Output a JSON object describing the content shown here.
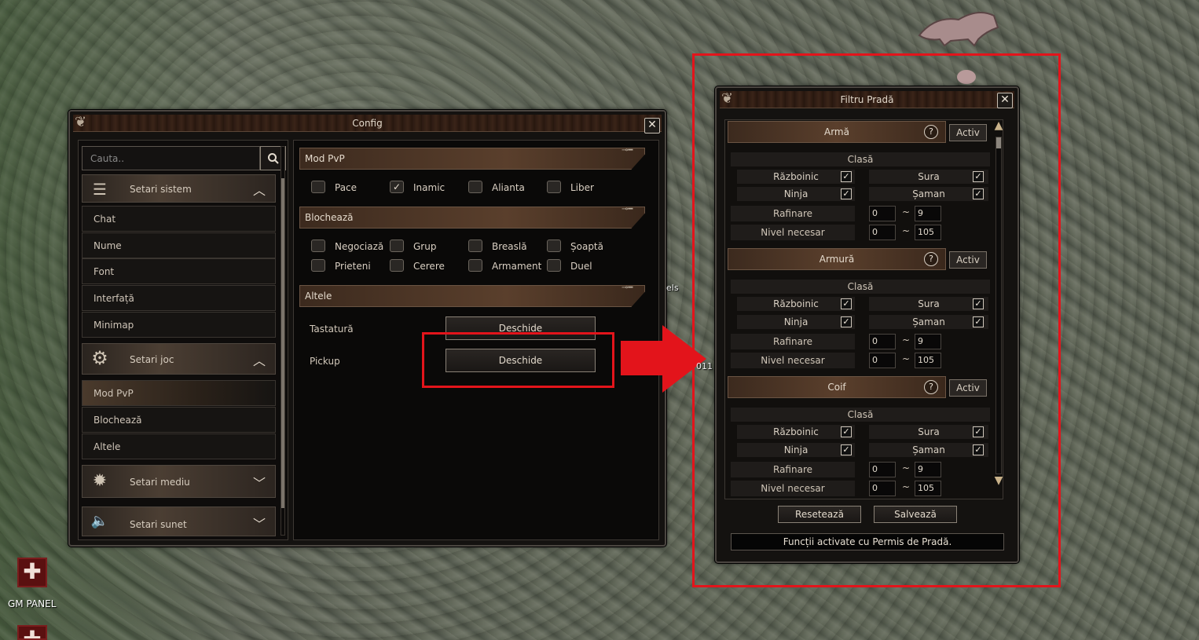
{
  "config": {
    "title": "Config",
    "search_placeholder": "Cauta..",
    "categories": [
      {
        "label": "Setari sistem",
        "icon": "list-icon",
        "expanded": true
      },
      {
        "label": "Setari joc",
        "icon": "gear-icon",
        "expanded": true
      },
      {
        "label": "Setari mediu",
        "icon": "sun-icon",
        "expanded": false
      },
      {
        "label": "Setari sunet",
        "icon": "speaker-icon",
        "expanded": false
      }
    ],
    "system_items": [
      "Chat",
      "Nume",
      "Font",
      "Interfață",
      "Minimap"
    ],
    "game_items": [
      "Mod PvP",
      "Blochează",
      "Altele"
    ],
    "sections": {
      "pvp": {
        "title": "Mod PvP",
        "options": [
          {
            "label": "Pace",
            "checked": false
          },
          {
            "label": "Inamic",
            "checked": true
          },
          {
            "label": "Alianta",
            "checked": false
          },
          {
            "label": "Liber",
            "checked": false
          }
        ]
      },
      "block": {
        "title": "Blochează",
        "options": [
          {
            "label": "Negociază",
            "checked": false
          },
          {
            "label": "Grup",
            "checked": false
          },
          {
            "label": "Breaslă",
            "checked": false
          },
          {
            "label": "Șoaptă",
            "checked": false
          },
          {
            "label": "Prieteni",
            "checked": false
          },
          {
            "label": "Cerere",
            "checked": false
          },
          {
            "label": "Armament",
            "checked": false
          },
          {
            "label": "Duel",
            "checked": false
          }
        ]
      },
      "other": {
        "title": "Altele",
        "rows": [
          {
            "label": "Tastatură",
            "button": "Deschide"
          },
          {
            "label": "Pickup",
            "button": "Deschide"
          }
        ]
      }
    }
  },
  "loot_filter": {
    "title": "Filtru Pradă",
    "class_label": "Clasă",
    "activ_label": "Activ",
    "help_symbol": "?",
    "tilde": "~",
    "items": [
      {
        "name": "Armă",
        "classes": [
          {
            "name": "Războinic",
            "checked": true
          },
          {
            "name": "Sura",
            "checked": true
          },
          {
            "name": "Ninja",
            "checked": true
          },
          {
            "name": "Șaman",
            "checked": true
          }
        ],
        "refine": {
          "label": "Rafinare",
          "min": "0",
          "max": "9"
        },
        "level": {
          "label": "Nivel necesar",
          "min": "0",
          "max": "105"
        }
      },
      {
        "name": "Armură",
        "classes": [
          {
            "name": "Războinic",
            "checked": true
          },
          {
            "name": "Sura",
            "checked": true
          },
          {
            "name": "Ninja",
            "checked": true
          },
          {
            "name": "Șaman",
            "checked": true
          }
        ],
        "refine": {
          "label": "Rafinare",
          "min": "0",
          "max": "9"
        },
        "level": {
          "label": "Nivel necesar",
          "min": "0",
          "max": "105"
        }
      },
      {
        "name": "Coif",
        "classes": [
          {
            "name": "Războinic",
            "checked": true
          },
          {
            "name": "Sura",
            "checked": true
          },
          {
            "name": "Ninja",
            "checked": true
          },
          {
            "name": "Șaman",
            "checked": true
          }
        ],
        "refine": {
          "label": "Rafinare",
          "min": "0",
          "max": "9"
        },
        "level": {
          "label": "Nivel necesar",
          "min": "0",
          "max": "105"
        }
      }
    ],
    "reset_label": "Resetează",
    "save_label": "Salvează",
    "status": "Funcții activate cu Permis de Pradă."
  },
  "hud": {
    "gm_panel_label": "GM PANEL",
    "side_text_1": "els",
    "side_text_2": "011"
  },
  "colors": {
    "highlight": "#e3141b",
    "window_bg": "#141210",
    "section_bar": "#5a3f2c"
  }
}
